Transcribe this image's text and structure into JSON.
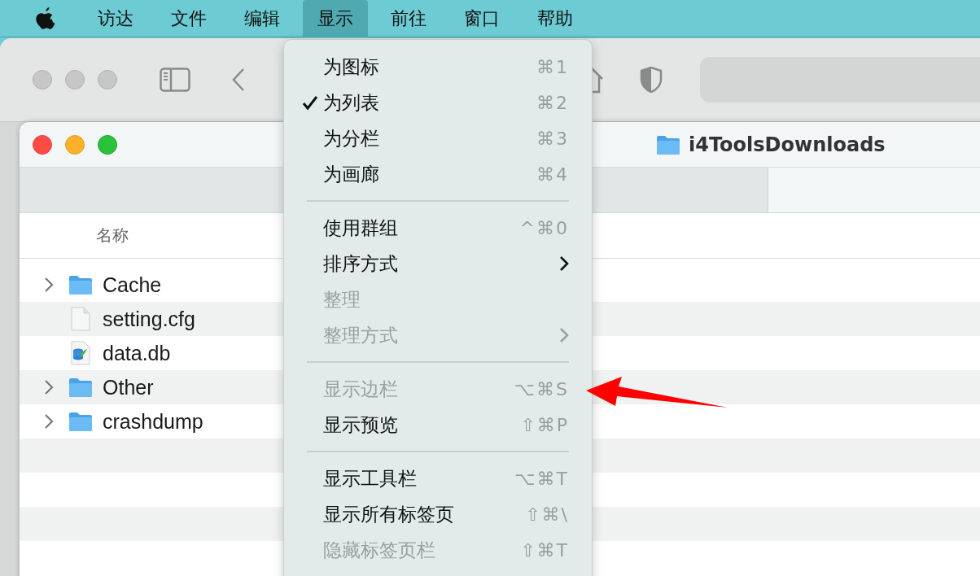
{
  "menu_bar": [
    {
      "label": "访达",
      "selected": false
    },
    {
      "label": "文件",
      "selected": false
    },
    {
      "label": "编辑",
      "selected": false
    },
    {
      "label": "显示",
      "selected": true
    },
    {
      "label": "前往",
      "selected": false
    },
    {
      "label": "窗口",
      "selected": false
    },
    {
      "label": "帮助",
      "selected": false
    }
  ],
  "window": {
    "title": "i4ToolsDownloads"
  },
  "table": {
    "columns": [
      "名称"
    ],
    "rows": [
      {
        "name": "Cache",
        "kind": "folder",
        "expanded": false
      },
      {
        "name": "setting.cfg",
        "kind": "file"
      },
      {
        "name": "data.db",
        "kind": "database"
      },
      {
        "name": "Other",
        "kind": "folder",
        "expanded": false
      },
      {
        "name": "crashdump",
        "kind": "folder",
        "expanded": false
      }
    ]
  },
  "menu": {
    "items": [
      {
        "kind": "item",
        "label": "为图标",
        "shortcut": "⌘1",
        "checked": false,
        "disabled": false,
        "submenu": false
      },
      {
        "kind": "item",
        "label": "为列表",
        "shortcut": "⌘2",
        "checked": true,
        "disabled": false,
        "submenu": false
      },
      {
        "kind": "item",
        "label": "为分栏",
        "shortcut": "⌘3",
        "checked": false,
        "disabled": false,
        "submenu": false
      },
      {
        "kind": "item",
        "label": "为画廊",
        "shortcut": "⌘4",
        "checked": false,
        "disabled": false,
        "submenu": false
      },
      {
        "kind": "separator"
      },
      {
        "kind": "item",
        "label": "使用群组",
        "shortcut": "^⌘0",
        "checked": false,
        "disabled": false,
        "submenu": false
      },
      {
        "kind": "item",
        "label": "排序方式",
        "checked": false,
        "disabled": false,
        "submenu": true
      },
      {
        "kind": "item",
        "label": "整理",
        "checked": false,
        "disabled": true,
        "submenu": false
      },
      {
        "kind": "item",
        "label": "整理方式",
        "checked": false,
        "disabled": true,
        "submenu": true
      },
      {
        "kind": "separator"
      },
      {
        "kind": "item",
        "label": "显示边栏",
        "shortcut": "⌥⌘S",
        "checked": false,
        "disabled": true,
        "submenu": false
      },
      {
        "kind": "item",
        "label": "显示预览",
        "shortcut": "⇧⌘P",
        "checked": false,
        "disabled": false,
        "submenu": false
      },
      {
        "kind": "separator"
      },
      {
        "kind": "item",
        "label": "显示工具栏",
        "shortcut": "⌥⌘T",
        "checked": false,
        "disabled": false,
        "submenu": false
      },
      {
        "kind": "item",
        "label": "显示所有标签页",
        "shortcut": "⇧⌘\\",
        "checked": false,
        "disabled": false,
        "submenu": false
      },
      {
        "kind": "item",
        "label": "隐藏标签页栏",
        "shortcut": "⇧⌘T",
        "checked": false,
        "disabled": true,
        "submenu": false
      }
    ]
  }
}
